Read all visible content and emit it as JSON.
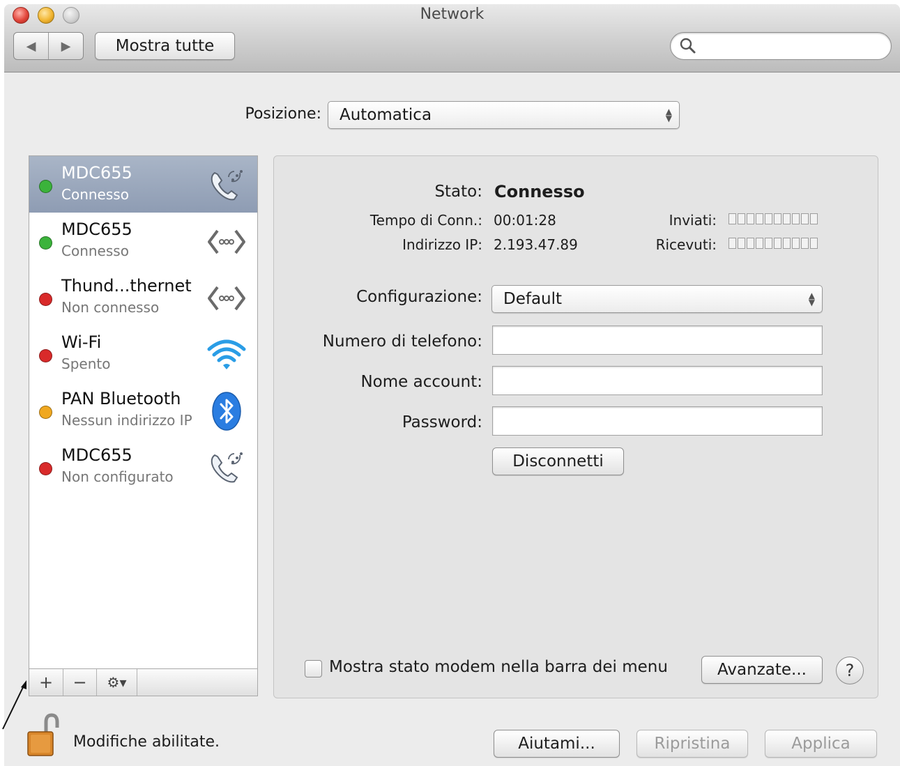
{
  "window": {
    "title": "Network"
  },
  "toolbar": {
    "back_glyph": "◀",
    "forward_glyph": "▶",
    "show_all_label": "Mostra tutte",
    "search_placeholder": ""
  },
  "location": {
    "label": "Posizione:",
    "value": "Automatica"
  },
  "services": [
    {
      "name": "MDC655",
      "status": "Connesso",
      "dot_color": "#3bb33b",
      "icon": "phone-icon",
      "selected": true
    },
    {
      "name": "MDC655",
      "status": "Connesso",
      "dot_color": "#3bb33b",
      "icon": "ethernet-icon",
      "selected": false
    },
    {
      "name": "Thund...thernet",
      "status": "Non connesso",
      "dot_color": "#d92a2a",
      "icon": "ethernet-icon",
      "selected": false
    },
    {
      "name": "Wi-Fi",
      "status": "Spento",
      "dot_color": "#d92a2a",
      "icon": "wifi-icon",
      "selected": false
    },
    {
      "name": "PAN Bluetooth",
      "status": "Nessun indirizzo IP",
      "dot_color": "#f0a820",
      "icon": "bluetooth-icon",
      "selected": false
    },
    {
      "name": "MDC655",
      "status": "Non configurato",
      "dot_color": "#d92a2a",
      "icon": "phone-icon",
      "selected": false
    }
  ],
  "sidebar_controls": {
    "add": "+",
    "remove": "−",
    "action": "⚙▾"
  },
  "detail": {
    "status_label": "Stato:",
    "status_value": "Connesso",
    "conn_time_label": "Tempo di Conn.:",
    "conn_time_value": "00:01:28",
    "ip_label": "Indirizzo IP:",
    "ip_value": "2.193.47.89",
    "sent_label": "Inviati:",
    "received_label": "Ricevuti:",
    "config_label": "Configurazione:",
    "config_value": "Default",
    "phone_label": "Numero di telefono:",
    "phone_value": "",
    "account_label": "Nome account:",
    "account_value": "",
    "password_label": "Password:",
    "password_value": "",
    "disconnect_label": "Disconnetti",
    "show_modem_label": "Mostra stato modem nella barra dei menu",
    "show_modem_checked": false,
    "advanced_label": "Avanzate...",
    "help_label": "?"
  },
  "footer": {
    "lock_text": "Modifiche abilitate.",
    "assist_label": "Aiutami...",
    "revert_label": "Ripristina",
    "apply_label": "Applica"
  },
  "colors": {
    "selection": "#97a5bb",
    "connected": "#3bb33b",
    "disconnected": "#d92a2a",
    "warning": "#f0a820",
    "bluetooth": "#2a7de1",
    "wifi": "#2a9de6"
  }
}
